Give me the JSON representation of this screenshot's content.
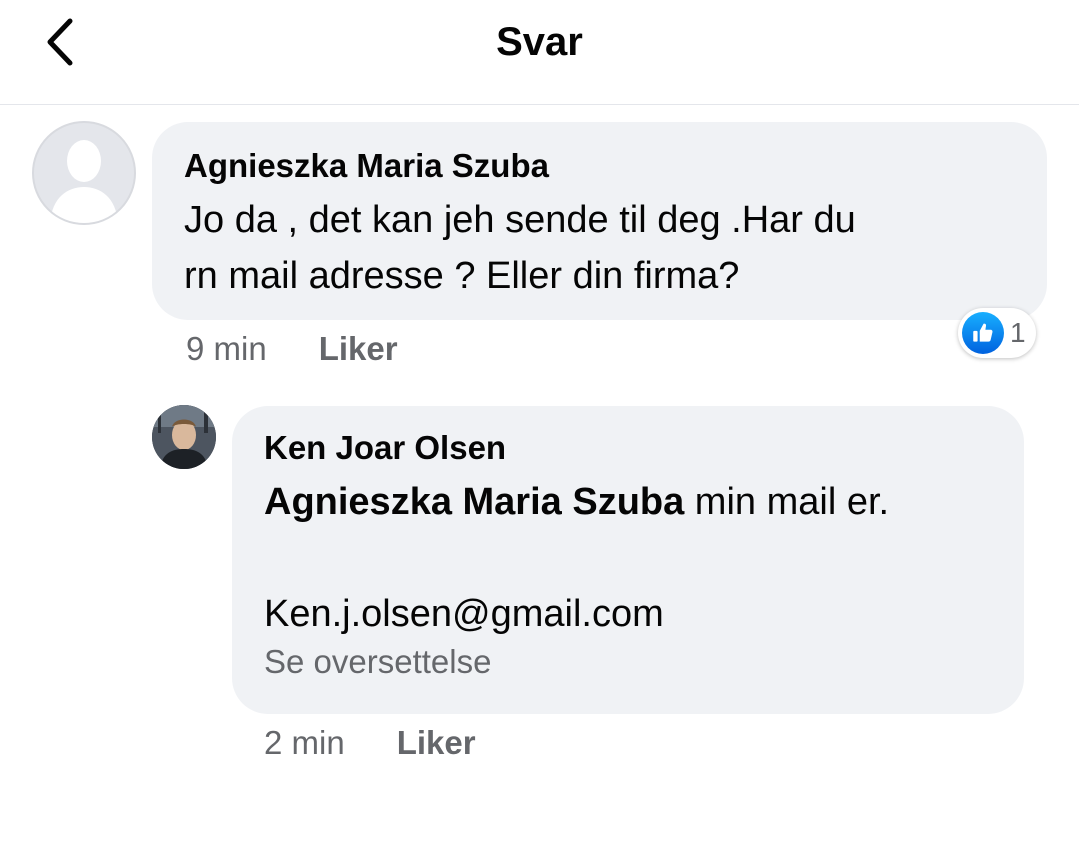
{
  "header": {
    "title": "Svar"
  },
  "comments": [
    {
      "author": "Agnieszka Maria Szuba",
      "text_line1": "Jo da , det kan jeh sende til deg .Har du",
      "text_line2": "rn mail adresse ? Eller din firma?",
      "time": "9 min",
      "like_label": "Liker",
      "reaction_count": "1"
    },
    {
      "author": "Ken Joar Olsen",
      "mention": "Agnieszka Maria Szuba",
      "text_after_mention": " min mail er.",
      "email": "Ken.j.olsen@gmail.com",
      "translate_label": "Se oversettelse",
      "time": "2 min",
      "like_label": "Liker"
    }
  ],
  "colors": {
    "bubble": "#f0f2f5",
    "muted_text": "#65676b",
    "like_blue": "#0866ff"
  },
  "icons": [
    "chevron-left-icon",
    "default-avatar-icon",
    "thumbs-up-icon"
  ]
}
